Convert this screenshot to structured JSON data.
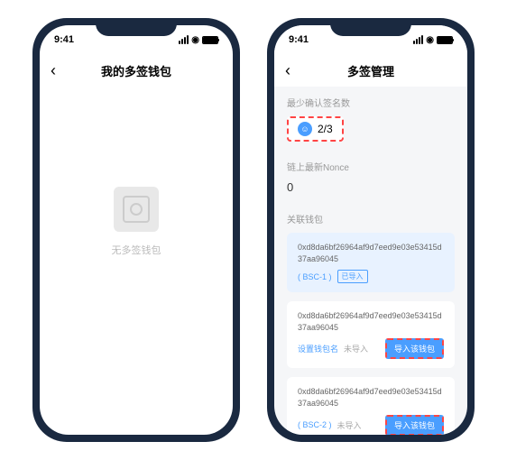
{
  "status": {
    "time": "9:41"
  },
  "phone1": {
    "title": "我的多签钱包",
    "empty_text": "无多签钱包"
  },
  "phone2": {
    "title": "多签管理",
    "sig_label": "最少确认签名数",
    "sig_value": "2/3",
    "nonce_label": "链上最新Nonce",
    "nonce_value": "0",
    "assoc_label": "关联钱包",
    "wallets": [
      {
        "addr": "0xd8da6bf26964af9d7eed9e03e53415d37aa96045",
        "tag": "( BSC-1 )",
        "status": "已导入",
        "imported": true
      },
      {
        "addr": "0xd8da6bf26964af9d7eed9e03e53415d37aa96045",
        "name": "设置钱包名",
        "status": "未导入",
        "btn": "导入该钱包",
        "imported": false
      },
      {
        "addr": "0xd8da6bf26964af9d7eed9e03e53415d37aa96045",
        "tag": "( BSC-2 )",
        "status": "未导入",
        "btn": "导入该钱包",
        "imported": false
      }
    ]
  }
}
